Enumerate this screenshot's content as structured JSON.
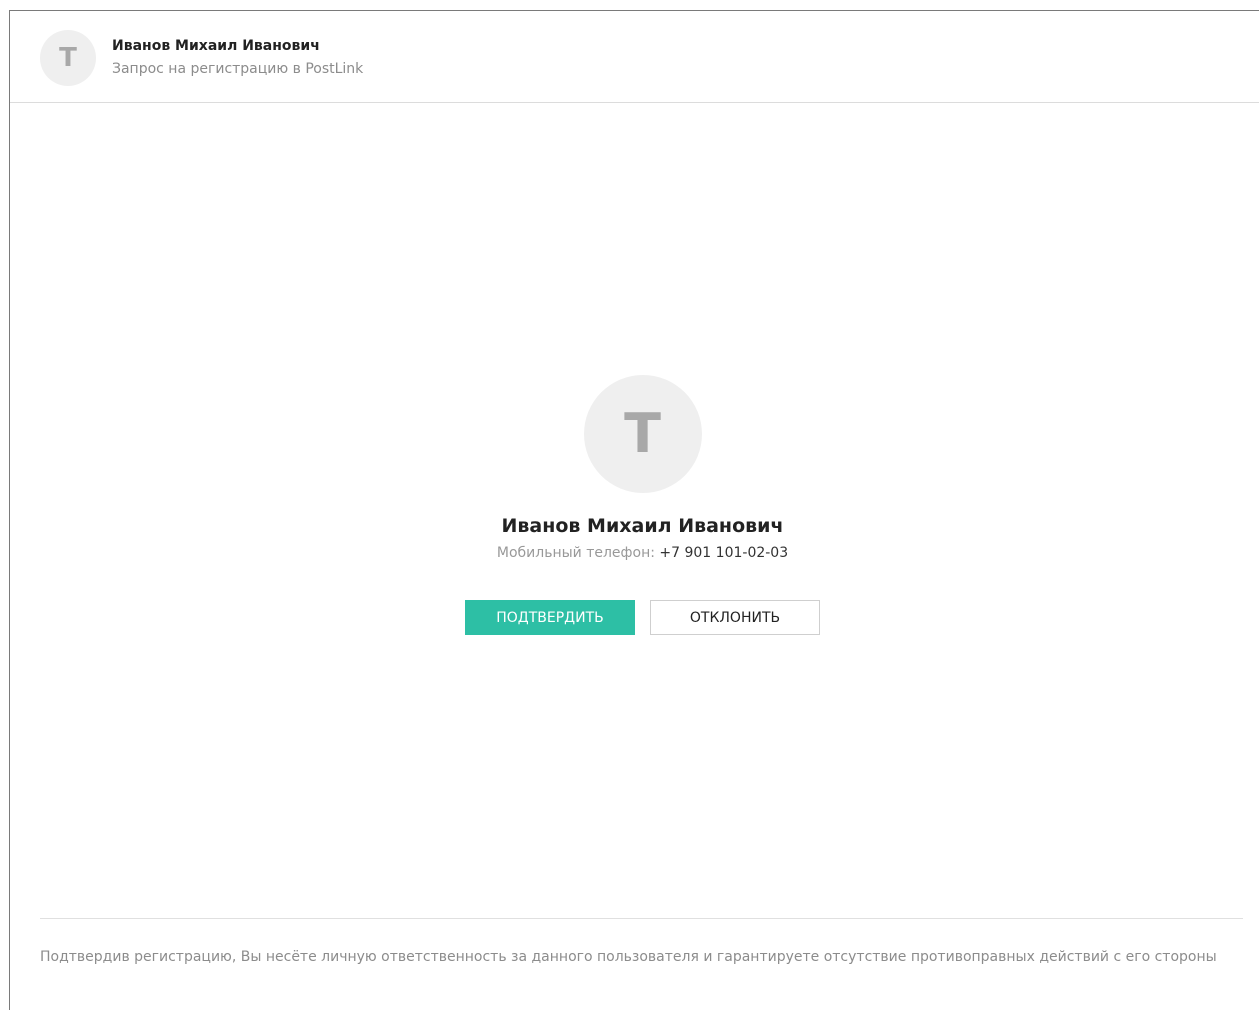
{
  "header": {
    "avatar_letter": "Т",
    "name": "Иванов Михаил Иванович",
    "subtitle": "Запрос на регистрацию в PostLink"
  },
  "profile": {
    "avatar_letter": "Т",
    "name": "Иванов Михаил Иванович",
    "phone_label": "Мобильный телефон:",
    "phone_value": "+7  901 101-02-03"
  },
  "actions": {
    "confirm_label": "ПОДТВЕРДИТЬ",
    "decline_label": "ОТКЛОНИТЬ"
  },
  "footer": {
    "disclaimer": "Подтвердив регистрацию, Вы несёте личную ответственность за данного пользователя и гарантируете отсутствие противоправных действий с его стороны"
  },
  "colors": {
    "accent": "#2dbfa5",
    "avatar_bg": "#efefef",
    "avatar_letter": "#a8a8a8",
    "muted_text": "#8c8c8c"
  }
}
